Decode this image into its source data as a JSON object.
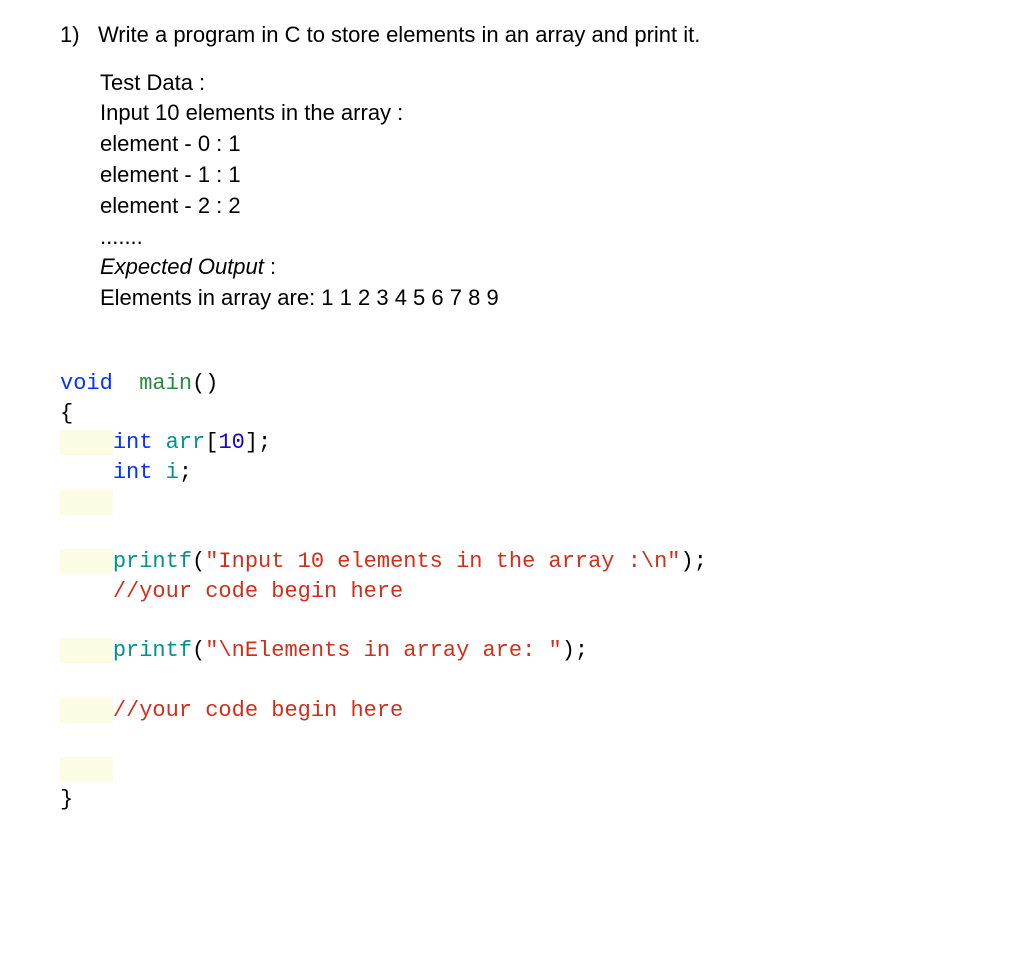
{
  "question": {
    "number": "1)",
    "title": "Write a program in C to store elements in an array and print it.",
    "test_data_label": "Test Data :",
    "input_label": "Input 10 elements in the array :",
    "elements": [
      "element - 0 : 1",
      "element - 1 : 1",
      "element - 2 : 2"
    ],
    "dots": ".......",
    "expected_output_label": "Expected Output",
    "expected_colon": " :",
    "expected_output": "Elements in array are: 1 1 2 3 4 5 6 7 8 9"
  },
  "code": {
    "kw_void": "void",
    "fn_main": "main",
    "parens": "()",
    "brace_open": "{",
    "kw_int1": "int",
    "arr_name": "arr",
    "arr_open": "[",
    "arr_size": "10",
    "arr_close": "];",
    "kw_int2": "int",
    "var_i": "i",
    "semi": ";",
    "printf1": "printf",
    "paren_open1": "(",
    "str1": "\"Input 10 elements in the array :\\n\"",
    "paren_close1": ");",
    "comment1": "//your code begin here",
    "printf2": "printf",
    "paren_open2": "(",
    "str2": "\"\\nElements in array are: \"",
    "paren_close2": ");",
    "comment2": "//your code begin here",
    "brace_close": "}"
  }
}
